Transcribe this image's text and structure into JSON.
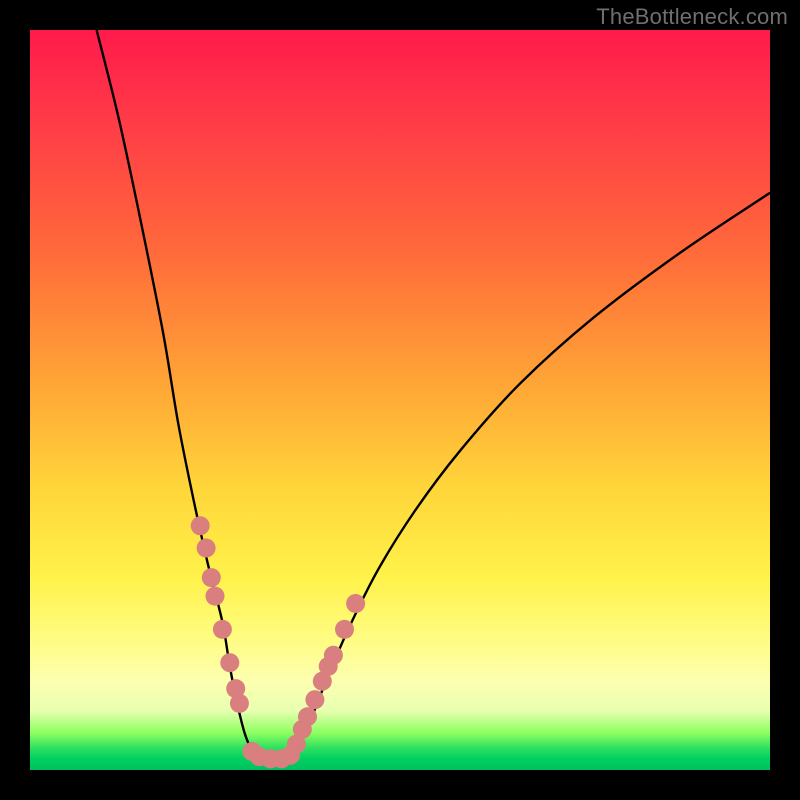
{
  "watermark": "TheBottleneck.com",
  "chart_data": {
    "type": "line",
    "title": "",
    "xlabel": "",
    "ylabel": "",
    "xlim": [
      0,
      100
    ],
    "ylim": [
      0,
      100
    ],
    "grid": false,
    "legend": false,
    "note": "V-shaped bottleneck curve over red-to-green vertical gradient. Axes have no numeric tick labels in the image; values below are estimated in normalized 0–100 screen units (x left→right, y bottom→top).",
    "series": [
      {
        "name": "curve-left-branch",
        "color": "#000000",
        "x": [
          9,
          12,
          15,
          18,
          20,
          22,
          24,
          26,
          27,
          28,
          29,
          30,
          30.5
        ],
        "y": [
          100,
          88,
          74,
          59,
          47,
          37,
          28,
          20,
          14,
          9,
          5,
          2.5,
          1.5
        ]
      },
      {
        "name": "curve-bottom",
        "color": "#000000",
        "x": [
          30.5,
          32,
          33.5,
          35
        ],
        "y": [
          1.5,
          1.2,
          1.2,
          1.5
        ]
      },
      {
        "name": "curve-right-branch",
        "color": "#000000",
        "x": [
          35,
          36,
          38,
          40,
          43,
          47,
          52,
          58,
          66,
          76,
          88,
          100
        ],
        "y": [
          1.5,
          3,
          7,
          12,
          19,
          27,
          35,
          43,
          52,
          61,
          70,
          78
        ]
      },
      {
        "name": "pink-dots",
        "color": "#d97f7f",
        "marker": "circle",
        "x": [
          23.0,
          23.8,
          24.5,
          25.0,
          26.0,
          27.0,
          27.8,
          28.3,
          30.0,
          31.0,
          32.5,
          34.0,
          35.2,
          36.0,
          36.8,
          37.5,
          38.5,
          39.5,
          40.3,
          41.0,
          42.5,
          44.0
        ],
        "y": [
          33.0,
          30.0,
          26.0,
          23.5,
          19.0,
          14.5,
          11.0,
          9.0,
          2.5,
          1.8,
          1.5,
          1.5,
          2.0,
          3.5,
          5.5,
          7.2,
          9.5,
          12.0,
          14.0,
          15.5,
          19.0,
          22.5
        ]
      }
    ],
    "background_gradient": {
      "direction": "vertical",
      "stops": [
        {
          "pos": 0.0,
          "color": "#ff1a4a"
        },
        {
          "pos": 0.3,
          "color": "#ff6a3a"
        },
        {
          "pos": 0.62,
          "color": "#ffd63a"
        },
        {
          "pos": 0.88,
          "color": "#fdffb0"
        },
        {
          "pos": 0.95,
          "color": "#8cff60"
        },
        {
          "pos": 1.0,
          "color": "#00c060"
        }
      ]
    }
  }
}
